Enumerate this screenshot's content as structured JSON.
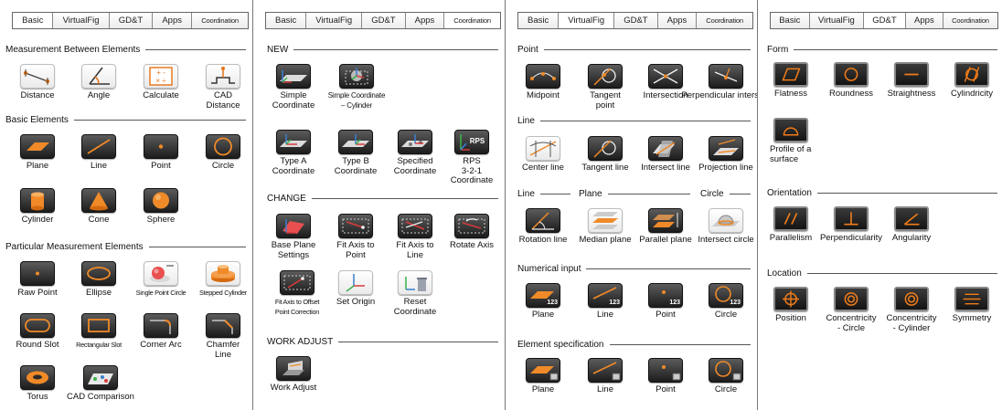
{
  "panels": [
    {
      "tabs": [
        "Basic",
        "VirtualFig",
        "GD&T",
        "Apps",
        "Coordination"
      ],
      "active_tab": "Basic",
      "sections": {
        "s0": "Measurement Between Elements",
        "s1": "Basic Elements",
        "s2": "Particular Measurement Elements"
      },
      "items": {
        "distance": "Distance",
        "angle": "Angle",
        "calculate": "Calculate",
        "cad_distance": "CAD\nDistance",
        "plane": "Plane",
        "line": "Line",
        "point": "Point",
        "circle": "Circle",
        "cylinder": "Cylinder",
        "cone": "Cone",
        "sphere": "Sphere",
        "raw_point": "Raw Point",
        "ellipse": "Ellipse",
        "single_point_circle": "Single Point Circle",
        "stepped_cylinder": "Stepped Cylinder",
        "round_slot": "Round Slot",
        "rectangular_slot": "Rectangular Slot",
        "corner_arc": "Corner Arc",
        "chamfer_line": "Chamfer\nLine",
        "torus": "Torus",
        "cad_comparison": "CAD Comparison"
      }
    },
    {
      "tabs": [
        "Basic",
        "VirtualFig",
        "GD&T",
        "Apps",
        "Coordination"
      ],
      "active_tab": "Coordination",
      "sections": {
        "s0": "NEW",
        "s1": "CHANGE",
        "s2": "WORK ADJUST"
      },
      "items": {
        "simple_coordinate": "Simple\nCoordinate",
        "simple_coordinate_cylinder": "Simple Coordinate\n– Cylinder",
        "type_a": "Type A\nCoordinate",
        "type_b": "Type B\nCoordinate",
        "specified": "Specified\nCoordinate",
        "rps": "RPS\n3-2-1\nCoordinate",
        "rps_badge": "RPS",
        "base_plane": "Base Plane\nSettings",
        "fit_point": "Fit Axis to\nPoint",
        "fit_line": "Fit Axis to\nLine",
        "rotate_axis": "Rotate Axis",
        "fit_offset": "Fit Axis to Offset\nPoint Correction",
        "set_origin": "Set Origin",
        "reset": "Reset\nCoordinate",
        "work_adjust": "Work Adjust"
      }
    },
    {
      "tabs": [
        "Basic",
        "VirtualFig",
        "GD&T",
        "Apps",
        "Coordination"
      ],
      "active_tab": "VirtualFig",
      "sections": {
        "point": "Point",
        "line": "Line",
        "line2": "Line",
        "plane": "Plane",
        "circle": "Circle",
        "numerical": "Numerical input",
        "element_spec": "Element specification"
      },
      "items": {
        "midpoint": "Midpoint",
        "tangent_point": "Tangent\npoint",
        "intersection": "Intersection",
        "perp_intersect": "Perpendicular\nintersect",
        "center_line": "Center line",
        "tangent_line": "Tangent line",
        "intersect_line": "Intersect line",
        "projection_line": "Projection line",
        "rotation_line": "Rotation line",
        "median_plane": "Median plane",
        "parallel_plane": "Parallel plane",
        "intersect_circle": "Intersect circle",
        "num_plane": "Plane",
        "num_line": "Line",
        "num_point": "Point",
        "num_circle": "Circle",
        "badge": "123",
        "es_plane": "Plane",
        "es_line": "Line",
        "es_point": "Point",
        "es_circle": "Circle"
      }
    },
    {
      "tabs": [
        "Basic",
        "VirtualFig",
        "GD&T",
        "Apps",
        "Coordination"
      ],
      "active_tab": "GD&T",
      "sections": {
        "form": "Form",
        "orientation": "Orientation",
        "location": "Location"
      },
      "items": {
        "flatness": "Flatness",
        "roundness": "Roundness",
        "straightness": "Straightness",
        "cylindricity": "Cylindricity",
        "profile": "Profile of a\nsurface",
        "parallelism": "Parallelism",
        "perpendicularity": "Perpendicularity",
        "angularity": "Angularity",
        "position": "Position",
        "conc_circle": "Concentricity\n- Circle",
        "conc_cylinder": "Concentricity\n- Cylinder",
        "symmetry": "Symmetry"
      }
    }
  ],
  "colors": {
    "accent_orange": "#ef7d14",
    "icon_dark": "#2a2a2a",
    "gdt_symbol": "#f07c1a"
  }
}
